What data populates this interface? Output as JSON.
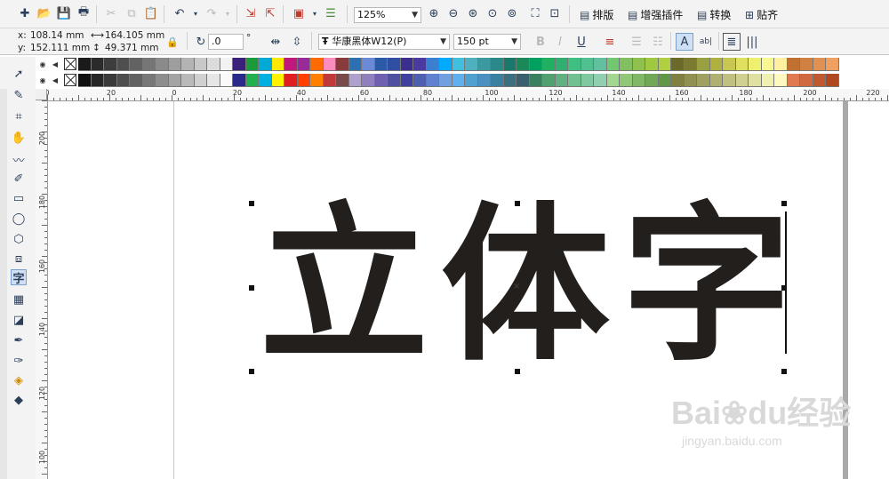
{
  "toolbar": {
    "zoom_value": "125%",
    "menu_buttons": [
      "排版",
      "增强插件",
      "转换",
      "贴齐"
    ]
  },
  "properties": {
    "x_label": "x:",
    "x_value": "108.14 mm",
    "y_label": "y:",
    "y_value": "152.111 mm",
    "width_value": "164.105 mm",
    "height_value": "49.371 mm",
    "rotation_value": ".0",
    "degree_symbol": "°",
    "font_name": "华康黑体W12(P)",
    "font_size": "150 pt"
  },
  "palette": {
    "row1": [
      "#1a1a1a",
      "#2b2b2b",
      "#3d3d3d",
      "#4f4f4f",
      "#626262",
      "#767676",
      "#8a8a8a",
      "#9e9e9e",
      "#b3b3b3",
      "#c8c8c8",
      "#dcdcdc",
      "#f2f2f2",
      "#3b1f7a",
      "#1a9a3a",
      "#00a9d6",
      "#ffe800",
      "#c2187e",
      "#9a2a9a",
      "#ff6a00",
      "#ff8cbf",
      "#8a3a3a",
      "#2f6fb4",
      "#6a8ad6",
      "#2a5aa8",
      "#2f4fa3",
      "#3a2f8f",
      "#4a3aa0",
      "#3a7fd0",
      "#00aaff",
      "#3fc0e0",
      "#4fb0c0",
      "#3a9aa0",
      "#2a8a8a",
      "#1a7a6a",
      "#1a8a5a",
      "#00a060",
      "#20b060",
      "#30b070",
      "#40c080",
      "#50c090",
      "#60c0a0",
      "#70c870",
      "#80c060",
      "#90c050",
      "#a0c840",
      "#b0d040",
      "#6a6a2a",
      "#7a7a30",
      "#9aa040",
      "#b0b040",
      "#c8c850",
      "#e0e060",
      "#f0f070",
      "#f8f890",
      "#fff0a0",
      "#c07030",
      "#d08040",
      "#e09050",
      "#f0a060"
    ],
    "row2": [
      "#111111",
      "#262626",
      "#3a3a3a",
      "#4e4e4e",
      "#626262",
      "#787878",
      "#8e8e8e",
      "#a4a4a4",
      "#bababa",
      "#d0d0d0",
      "#e6e6e6",
      "#fafafa",
      "#2a2a8a",
      "#20b050",
      "#00b0e0",
      "#fff200",
      "#e02020",
      "#ff4000",
      "#ff7f00",
      "#c03a3a",
      "#7a4a4a",
      "#b0a0d0",
      "#9080c0",
      "#7060b0",
      "#5050a0",
      "#4040a0",
      "#5060b0",
      "#6080d0",
      "#70a0e0",
      "#60b0f0",
      "#50a0d0",
      "#4a90c0",
      "#3a80a0",
      "#3a7080",
      "#3a6070",
      "#3a8060",
      "#50a070",
      "#60b080",
      "#70c090",
      "#80c8a0",
      "#90d0b0",
      "#a0d890",
      "#90c878",
      "#80b868",
      "#70a858",
      "#609848",
      "#808040",
      "#909050",
      "#a0a060",
      "#b0b070",
      "#c0c080",
      "#d0d090",
      "#e0e0a0",
      "#f0f0b0",
      "#fff8c0",
      "#e07850",
      "#d06840",
      "#c05830",
      "#b04820"
    ]
  },
  "rulers": {
    "h_labels": [
      "0",
      "20",
      "0",
      "20",
      "40",
      "60",
      "80",
      "100",
      "120",
      "140",
      "160",
      "180",
      "200",
      "220"
    ],
    "v_labels": [
      "200",
      "180",
      "160",
      "140",
      "120",
      "100"
    ]
  },
  "artwork": {
    "text": "立体字",
    "fill_color": "#231f1c"
  },
  "watermark": {
    "brand": "Bai",
    "brand2": "du",
    "cn": "经验",
    "url": "jingyan.baidu.com"
  }
}
